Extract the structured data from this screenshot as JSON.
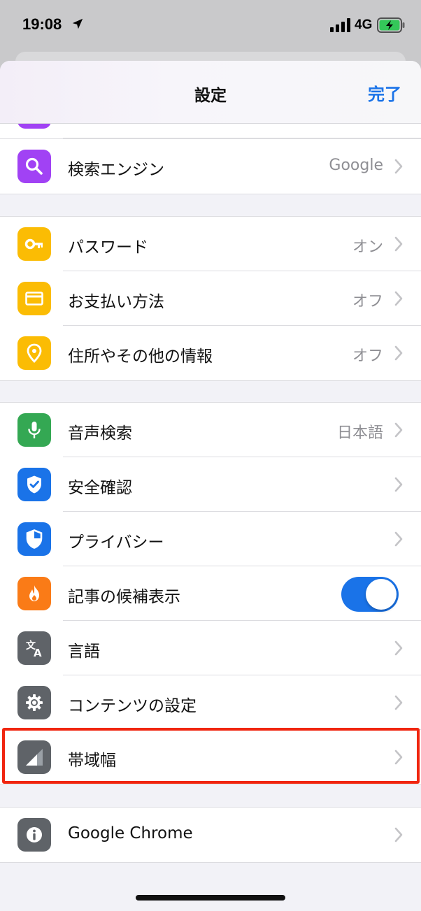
{
  "status_bar": {
    "time": "19:08",
    "network": "4G"
  },
  "nav": {
    "title": "設定",
    "done_label": "完了"
  },
  "groups": [
    {
      "name": "search",
      "rows": [
        {
          "label": "検索エンジン",
          "value": "Google",
          "icon": "search-icon",
          "color": "#a142f4"
        }
      ]
    },
    {
      "name": "autofill",
      "rows": [
        {
          "label": "パスワード",
          "value": "オン",
          "icon": "key-icon",
          "color": "#fbbc04"
        },
        {
          "label": "お支払い方法",
          "value": "オフ",
          "icon": "credit-card-icon",
          "color": "#fbbc04"
        },
        {
          "label": "住所やその他の情報",
          "value": "オフ",
          "icon": "location-pin-icon",
          "color": "#fbbc04"
        }
      ]
    },
    {
      "name": "general",
      "rows": [
        {
          "label": "音声検索",
          "value": "日本語",
          "icon": "microphone-icon",
          "color": "#34a853"
        },
        {
          "label": "安全確認",
          "value": "",
          "icon": "shield-check-icon",
          "color": "#1a73e8"
        },
        {
          "label": "プライバシー",
          "value": "",
          "icon": "shield-half-icon",
          "color": "#1a73e8"
        },
        {
          "label": "記事の候補表示",
          "value": "",
          "icon": "flame-icon",
          "color": "#fa7b17",
          "toggle": true
        },
        {
          "label": "言語",
          "value": "",
          "icon": "translate-icon",
          "color": "#5f6368"
        },
        {
          "label": "コンテンツの設定",
          "value": "",
          "icon": "gear-icon",
          "color": "#5f6368"
        },
        {
          "label": "帯域幅",
          "value": "",
          "icon": "signal-strength-icon",
          "color": "#5f6368"
        }
      ]
    },
    {
      "name": "about",
      "rows": [
        {
          "label": "Google Chrome",
          "value": "",
          "icon": "info-icon",
          "color": "#5f6368"
        }
      ]
    }
  ]
}
